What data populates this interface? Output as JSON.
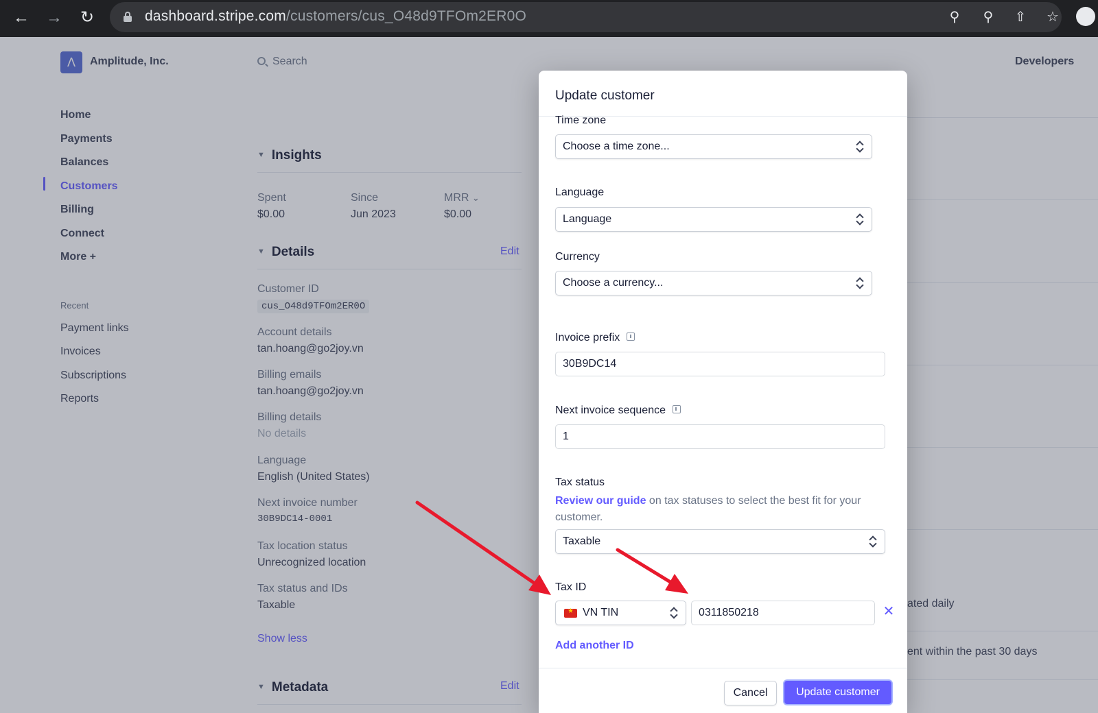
{
  "browser": {
    "url_host": "dashboard.stripe.com",
    "url_path": "/customers/cus_O48d9TFOm2ER0O"
  },
  "app": {
    "company": "Amplitude, Inc.",
    "search_placeholder": "Search",
    "developers": "Developers",
    "nav": [
      "Home",
      "Payments",
      "Balances",
      "Customers",
      "Billing",
      "Connect",
      "More +"
    ],
    "active_nav": "Customers",
    "recent_title": "Recent",
    "recent": [
      "Payment links",
      "Invoices",
      "Subscriptions",
      "Reports"
    ]
  },
  "insights": {
    "title": "Insights",
    "spent_label": "Spent",
    "spent_value": "$0.00",
    "since_label": "Since",
    "since_value": "Jun 2023",
    "mrr_label": "MRR",
    "mrr_value": "$0.00"
  },
  "details": {
    "title": "Details",
    "edit": "Edit",
    "customer_id_label": "Customer ID",
    "customer_id": "cus_O48d9TFOm2ER0O",
    "account_label": "Account details",
    "account_value": "tan.hoang@go2joy.vn",
    "billing_emails_label": "Billing emails",
    "billing_emails_value": "tan.hoang@go2joy.vn",
    "billing_details_label": "Billing details",
    "billing_details_value": "No details",
    "language_label": "Language",
    "language_value": "English (United States)",
    "next_invoice_label": "Next invoice number",
    "next_invoice_value": "30B9DC14-0001",
    "tax_location_label": "Tax location status",
    "tax_location_value": "Unrecognized location",
    "tax_status_label": "Tax status and IDs",
    "tax_status_value": "Taxable",
    "show_less": "Show less"
  },
  "metadata": {
    "title": "Metadata",
    "edit": "Edit"
  },
  "right_panel": {
    "text_1": "ated daily",
    "text_2": "ent within the past 30 days"
  },
  "modal": {
    "title": "Update customer",
    "time_zone_label": "Time zone",
    "time_zone_value": "Choose a time zone...",
    "language_label": "Language",
    "language_value": "Language",
    "currency_label": "Currency",
    "currency_value": "Choose a currency...",
    "invoice_prefix_label": "Invoice prefix",
    "invoice_prefix_value": "30B9DC14",
    "next_seq_label": "Next invoice sequence",
    "next_seq_value": "1",
    "tax_status_label": "Tax status",
    "tax_guide_link": "Review our guide",
    "tax_guide_text": " on tax statuses to select the best fit for your customer.",
    "tax_status_value": "Taxable",
    "tax_id_label": "Tax ID",
    "tax_id_type": "VN TIN",
    "tax_id_value": "0311850218",
    "add_another": "Add another ID",
    "cancel": "Cancel",
    "update": "Update customer"
  },
  "colors": {
    "accent": "#635bff",
    "annotation_arrow": "#e8192c"
  }
}
